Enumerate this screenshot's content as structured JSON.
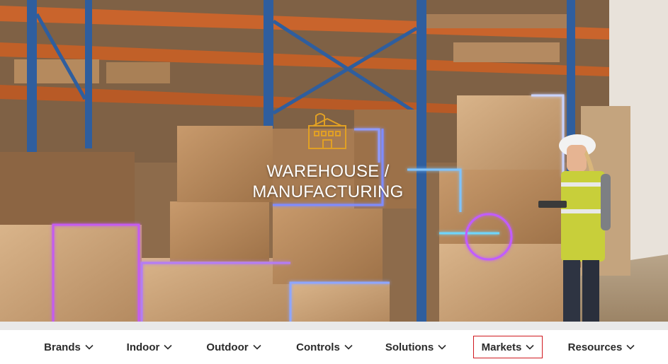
{
  "hero": {
    "title": "WAREHOUSE / MANUFACTURING",
    "icon": "factory-icon",
    "accent_color": "#e1a024"
  },
  "nav": {
    "items": [
      {
        "label": "Brands",
        "icon": "chevron-down-icon"
      },
      {
        "label": "Indoor",
        "icon": "chevron-down-icon"
      },
      {
        "label": "Outdoor",
        "icon": "chevron-down-icon"
      },
      {
        "label": "Controls",
        "icon": "chevron-down-icon"
      },
      {
        "label": "Solutions",
        "icon": "chevron-down-icon"
      },
      {
        "label": "Markets",
        "icon": "chevron-down-icon",
        "active": true
      },
      {
        "label": "Resources",
        "icon": "chevron-down-icon"
      }
    ],
    "active_border_color": "#d0191f"
  }
}
